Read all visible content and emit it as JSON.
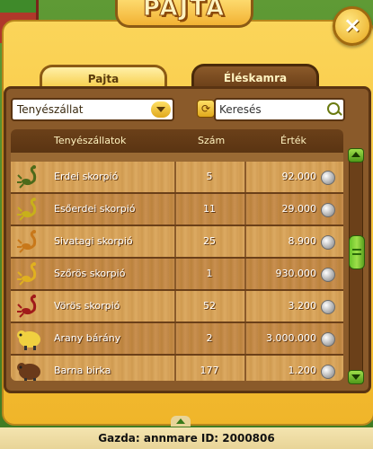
{
  "window": {
    "title": "PAJTA",
    "close_label": "×"
  },
  "tabs": [
    {
      "label": "Pajta",
      "active": true
    },
    {
      "label": "Éléskamra",
      "active": false
    }
  ],
  "filter": {
    "selected": "Tenyészállat"
  },
  "search": {
    "placeholder": "Keresés"
  },
  "table": {
    "headers": {
      "name": "Tenyészállatok",
      "count": "Szám",
      "value": "Érték"
    },
    "rows": [
      {
        "name": "Erdei skorpió",
        "count": "5",
        "value": "92.000",
        "icon": "scorpion-green-icon"
      },
      {
        "name": "Esőerdei skorpió",
        "count": "11",
        "value": "29.000",
        "icon": "scorpion-yellow-icon"
      },
      {
        "name": "Sivatagi skorpió",
        "count": "25",
        "value": "8.900",
        "icon": "scorpion-orange-icon"
      },
      {
        "name": "Szőrös skorpió",
        "count": "1",
        "value": "930.000",
        "icon": "scorpion-gold-icon"
      },
      {
        "name": "Vörös skorpió",
        "count": "52",
        "value": "3.200",
        "icon": "scorpion-red-icon"
      },
      {
        "name": "Arany bárány",
        "count": "2",
        "value": "3.000.000",
        "icon": "golden-sheep-icon"
      },
      {
        "name": "Barna birka",
        "count": "177",
        "value": "1.200",
        "icon": "brown-sheep-icon"
      }
    ]
  },
  "footer": {
    "text": "Gazda: annmare   ID: 2000806"
  },
  "colors": {
    "panel": "#f5c238",
    "board": "#8a5a2a",
    "header": "#5a3412",
    "scroll": "#6ac42a"
  }
}
